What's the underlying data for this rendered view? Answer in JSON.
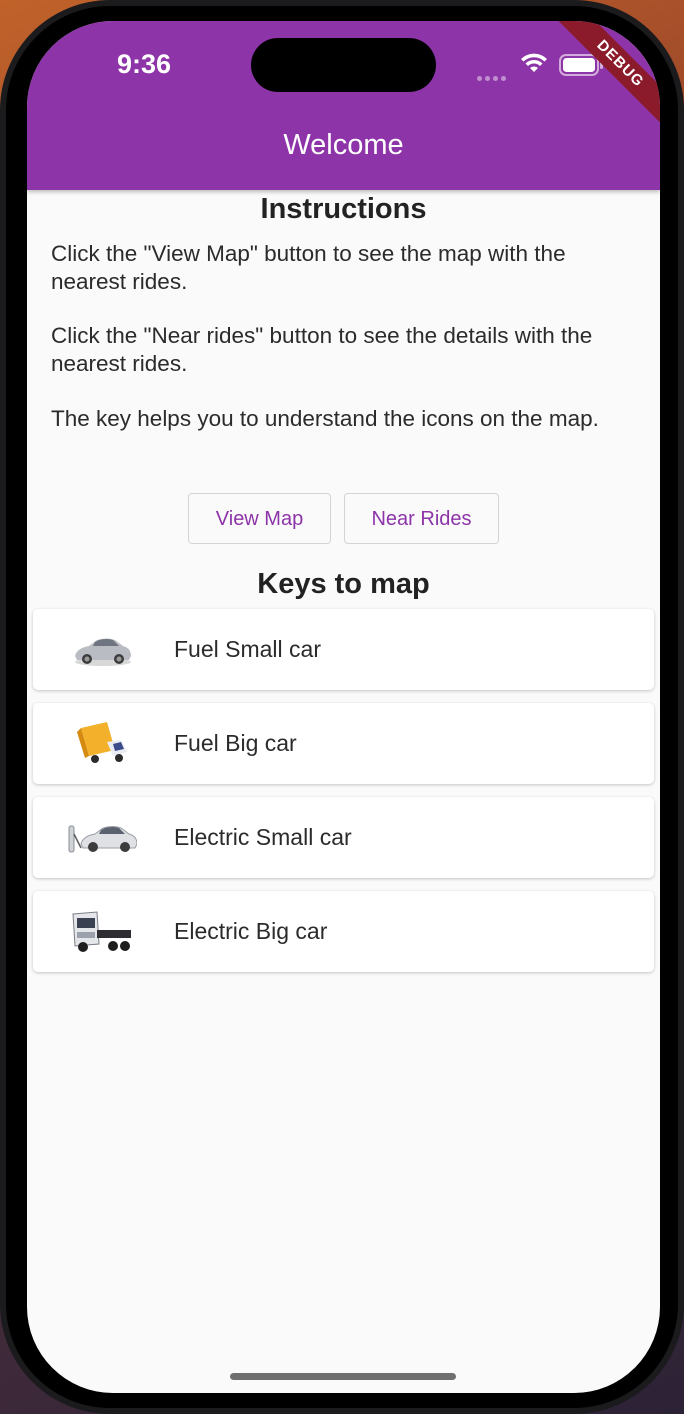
{
  "status_bar": {
    "time": "9:36",
    "debug_label": "DEBUG"
  },
  "appbar": {
    "title": "Welcome"
  },
  "instructions": {
    "title": "Instructions",
    "paragraphs": [
      "Click the \"View Map\" button to see the map with the nearest rides.",
      "Click the \"Near rides\" button to see the details with the nearest rides.",
      "The key helps you to understand the icons on the map."
    ]
  },
  "buttons": {
    "view_map": "View Map",
    "near_rides": "Near Rides"
  },
  "keys": {
    "title": "Keys to map",
    "items": [
      {
        "label": "Fuel Small car",
        "icon": "silver-sedan-icon"
      },
      {
        "label": "Fuel Big car",
        "icon": "yellow-truck-icon"
      },
      {
        "label": "Electric Small car",
        "icon": "electric-car-icon"
      },
      {
        "label": "Electric Big car",
        "icon": "truck-cab-icon"
      }
    ]
  },
  "colors": {
    "primary": "#8e34a9",
    "background": "#fafafa",
    "debug_banner": "#8b1a2a"
  }
}
